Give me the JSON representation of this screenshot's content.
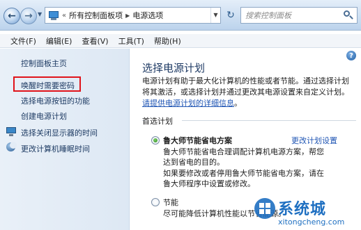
{
  "address_bar": {
    "breadcrumb_prefix": "«",
    "breadcrumbs": [
      "所有控制面板项",
      "电源选项"
    ],
    "search_placeholder": "搜索控制面板"
  },
  "menu": {
    "items": [
      "文件(F)",
      "编辑(E)",
      "查看(V)",
      "工具(T)",
      "帮助(H)"
    ]
  },
  "left_nav": {
    "home": "控制面板主页",
    "tasks": [
      {
        "label": "唤醒时需要密码",
        "highlighted": true
      },
      {
        "label": "选择电源按钮的功能"
      },
      {
        "label": "创建电源计划"
      },
      {
        "label": "选择关闭显示器的时间",
        "icon": "monitor-icon"
      },
      {
        "label": "更改计算机睡眠时间",
        "icon": "moon-icon"
      }
    ]
  },
  "main": {
    "title": "选择电源计划",
    "description": "电源计划有助于最大化计算机的性能或者节能。通过选择计划将其激活，或选择计划并通过更改其电源设置来自定义计划。",
    "description_link": "请提供电源计划的详细信息",
    "description_end": "。",
    "group_label": "首选计划",
    "plans": [
      {
        "name": "鲁大师节能省电方案",
        "selected": true,
        "change_link": "更改计划设置",
        "desc_1": "鲁大师节能省电合理调配计算机电源方案，帮您达到省电的目的。",
        "desc_2": "如果要修改或者停用鲁大师节能省电方案，请在鲁大师程序中设置或修改。"
      },
      {
        "name": "节能",
        "selected": false,
        "desc_1": "尽可能降低计算机性能以节省能源。"
      }
    ]
  },
  "watermark": {
    "title": "系统城",
    "url": "xitongcheng.com"
  },
  "colors": {
    "link": "#1f55b4",
    "highlight_box": "#e0131a",
    "title": "#1e3a64"
  }
}
